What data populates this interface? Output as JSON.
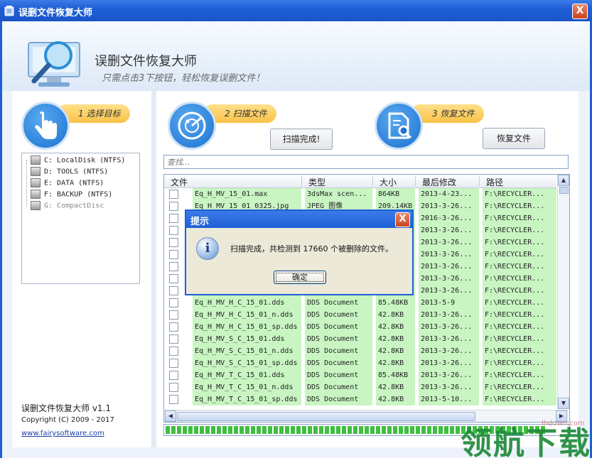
{
  "window": {
    "title": "误删文件恢复大师",
    "close_label": "X"
  },
  "header": {
    "app_name": "误删文件恢复大师",
    "subtitle": "只需点击3下按钮，轻松恢复误删文件！"
  },
  "steps": [
    {
      "label": "1 选择目标"
    },
    {
      "label": "2 扫描文件",
      "button": "扫描完成!"
    },
    {
      "label": "3 恢复文件",
      "button": "恢复文件"
    }
  ],
  "drives": [
    {
      "label": "C: LocalDisk (NTFS)"
    },
    {
      "label": "D: TOOLS (NTFS)"
    },
    {
      "label": "E: DATA (NTFS)"
    },
    {
      "label": "F: BACKUP (NTFS)"
    },
    {
      "label": "G: CompactDisc"
    }
  ],
  "search": {
    "placeholder": "查找..."
  },
  "table": {
    "columns": [
      "文件",
      "类型",
      "大小",
      "最后修改",
      "路径"
    ],
    "rows": [
      {
        "name": "Eq_H_MV_15_01.max",
        "type": "3dsMax scen...",
        "size": "864KB",
        "date": "2013-4-23...",
        "path": "F:\\RECYCLER..."
      },
      {
        "name": "Eq_H_MV_15_01_0325.jpg",
        "type": "JPEG 图像",
        "size": "209.14KB",
        "date": "2013-3-26...",
        "path": "F:\\RECYCLER..."
      },
      {
        "name": "",
        "type": "",
        "size": "",
        "date": "2016-3-26...",
        "path": "F:\\RECYCLER..."
      },
      {
        "name": "",
        "type": "",
        "size": "",
        "date": "2013-3-26...",
        "path": "F:\\RECYCLER..."
      },
      {
        "name": "",
        "type": "",
        "size": "",
        "date": "2013-3-26...",
        "path": "F:\\RECYCLER..."
      },
      {
        "name": "",
        "type": "",
        "size": "",
        "date": "2013-3-26...",
        "path": "F:\\RECYCLER..."
      },
      {
        "name": "",
        "type": "",
        "size": "",
        "date": "2013-3-26...",
        "path": "F:\\RECYCLER..."
      },
      {
        "name": "",
        "type": "",
        "size": "",
        "date": "2013-3-26...",
        "path": "F:\\RECYCLER..."
      },
      {
        "name": "",
        "type": "",
        "size": "",
        "date": "2013-3-26...",
        "path": "F:\\RECYCLER..."
      },
      {
        "name": "Eq_H_MV_H_C_15_01.dds",
        "type": "DDS Document",
        "size": "85.48KB",
        "date": "2013-5-9",
        "path": "F:\\RECYCLER..."
      },
      {
        "name": "Eq_H_MV_H_C_15_01_n.dds",
        "type": "DDS Document",
        "size": "42.8KB",
        "date": "2013-3-26...",
        "path": "F:\\RECYCLER..."
      },
      {
        "name": "Eq_H_MV_H_C_15_01_sp.dds",
        "type": "DDS Document",
        "size": "42.8KB",
        "date": "2013-3-26...",
        "path": "F:\\RECYCLER..."
      },
      {
        "name": "Eq_H_MV_S_C_15_01.dds",
        "type": "DDS Document",
        "size": "42.8KB",
        "date": "2013-3-26...",
        "path": "F:\\RECYCLER..."
      },
      {
        "name": "Eq_H_MV_S_C_15_01_n.dds",
        "type": "DDS Document",
        "size": "42.8KB",
        "date": "2013-3-26...",
        "path": "F:\\RECYCLER..."
      },
      {
        "name": "Eq_H_MV_S_C_15_01_sp.dds",
        "type": "DDS Document",
        "size": "42.8KB",
        "date": "2013-3-26...",
        "path": "F:\\RECYCLER..."
      },
      {
        "name": "Eq_H_MV_T_C_15_01.dds",
        "type": "DDS Document",
        "size": "85.48KB",
        "date": "2013-3-26...",
        "path": "F:\\RECYCLER..."
      },
      {
        "name": "Eq_H_MV_T_C_15_01_n.dds",
        "type": "DDS Document",
        "size": "42.8KB",
        "date": "2013-3-26...",
        "path": "F:\\RECYCLER..."
      },
      {
        "name": "Eq_H_MV_T_C_15_01_sp.dds",
        "type": "DDS Document",
        "size": "42.8KB",
        "date": "2013-5-10...",
        "path": "F:\\RECYCLER..."
      }
    ]
  },
  "progress": {
    "fraction": 0.95
  },
  "footer": {
    "version": "误删文件恢复大师 v1.1",
    "copyright": "Copyright (C) 2009 - 2017",
    "website": "www.fairysoftware.com"
  },
  "dialog": {
    "title": "提示",
    "message": "扫描完成，共检测到 17660 个被删除的文件。",
    "ok": "确定",
    "close": "X"
  },
  "watermark": {
    "text": "领航下载",
    "small": "lhdown.com"
  },
  "colors": {
    "titlebar": "#1f5fd6",
    "row_highlight": "#c8f5c2",
    "step_label": "#f9c247",
    "progress": "#3fbf3f"
  }
}
